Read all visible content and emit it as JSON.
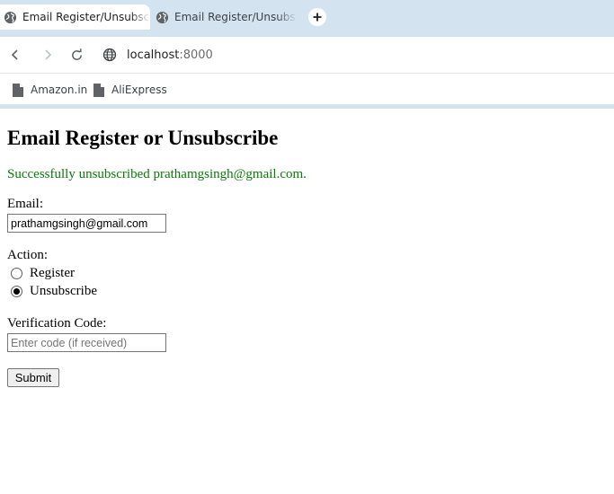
{
  "tabs": [
    {
      "title": "Email Register/Unsubscribe",
      "active": true
    },
    {
      "title": "Email Register/Unsubscribe",
      "active": false
    }
  ],
  "new_tab_icon": "plus-icon",
  "toolbar": {
    "back_icon": "back-arrow-icon",
    "forward_icon": "forward-arrow-icon",
    "reload_icon": "reload-icon",
    "site_icon": "globe-icon",
    "url_host": "localhost",
    "url_port": ":8000"
  },
  "bookmarks": [
    {
      "label": "Amazon.in",
      "icon": "page-icon"
    },
    {
      "label": "AliExpress",
      "icon": "page-icon"
    }
  ],
  "page": {
    "title": "Email Register or Unsubscribe",
    "message": "Successfully unsubscribed prathamgsingh@gmail.com.",
    "message_color": "#0a7a0a",
    "email_label": "Email:",
    "email_value": "prathamgsingh@gmail.com",
    "action_label": "Action:",
    "actions": [
      {
        "label": "Register",
        "selected": false
      },
      {
        "label": "Unsubscribe",
        "selected": true
      }
    ],
    "code_label": "Verification Code:",
    "code_placeholder": "Enter code (if received)",
    "code_value": "",
    "submit_label": "Submit"
  },
  "colors": {
    "chrome_frame": "#d3e3f0",
    "success_text": "#0a7a0a"
  }
}
